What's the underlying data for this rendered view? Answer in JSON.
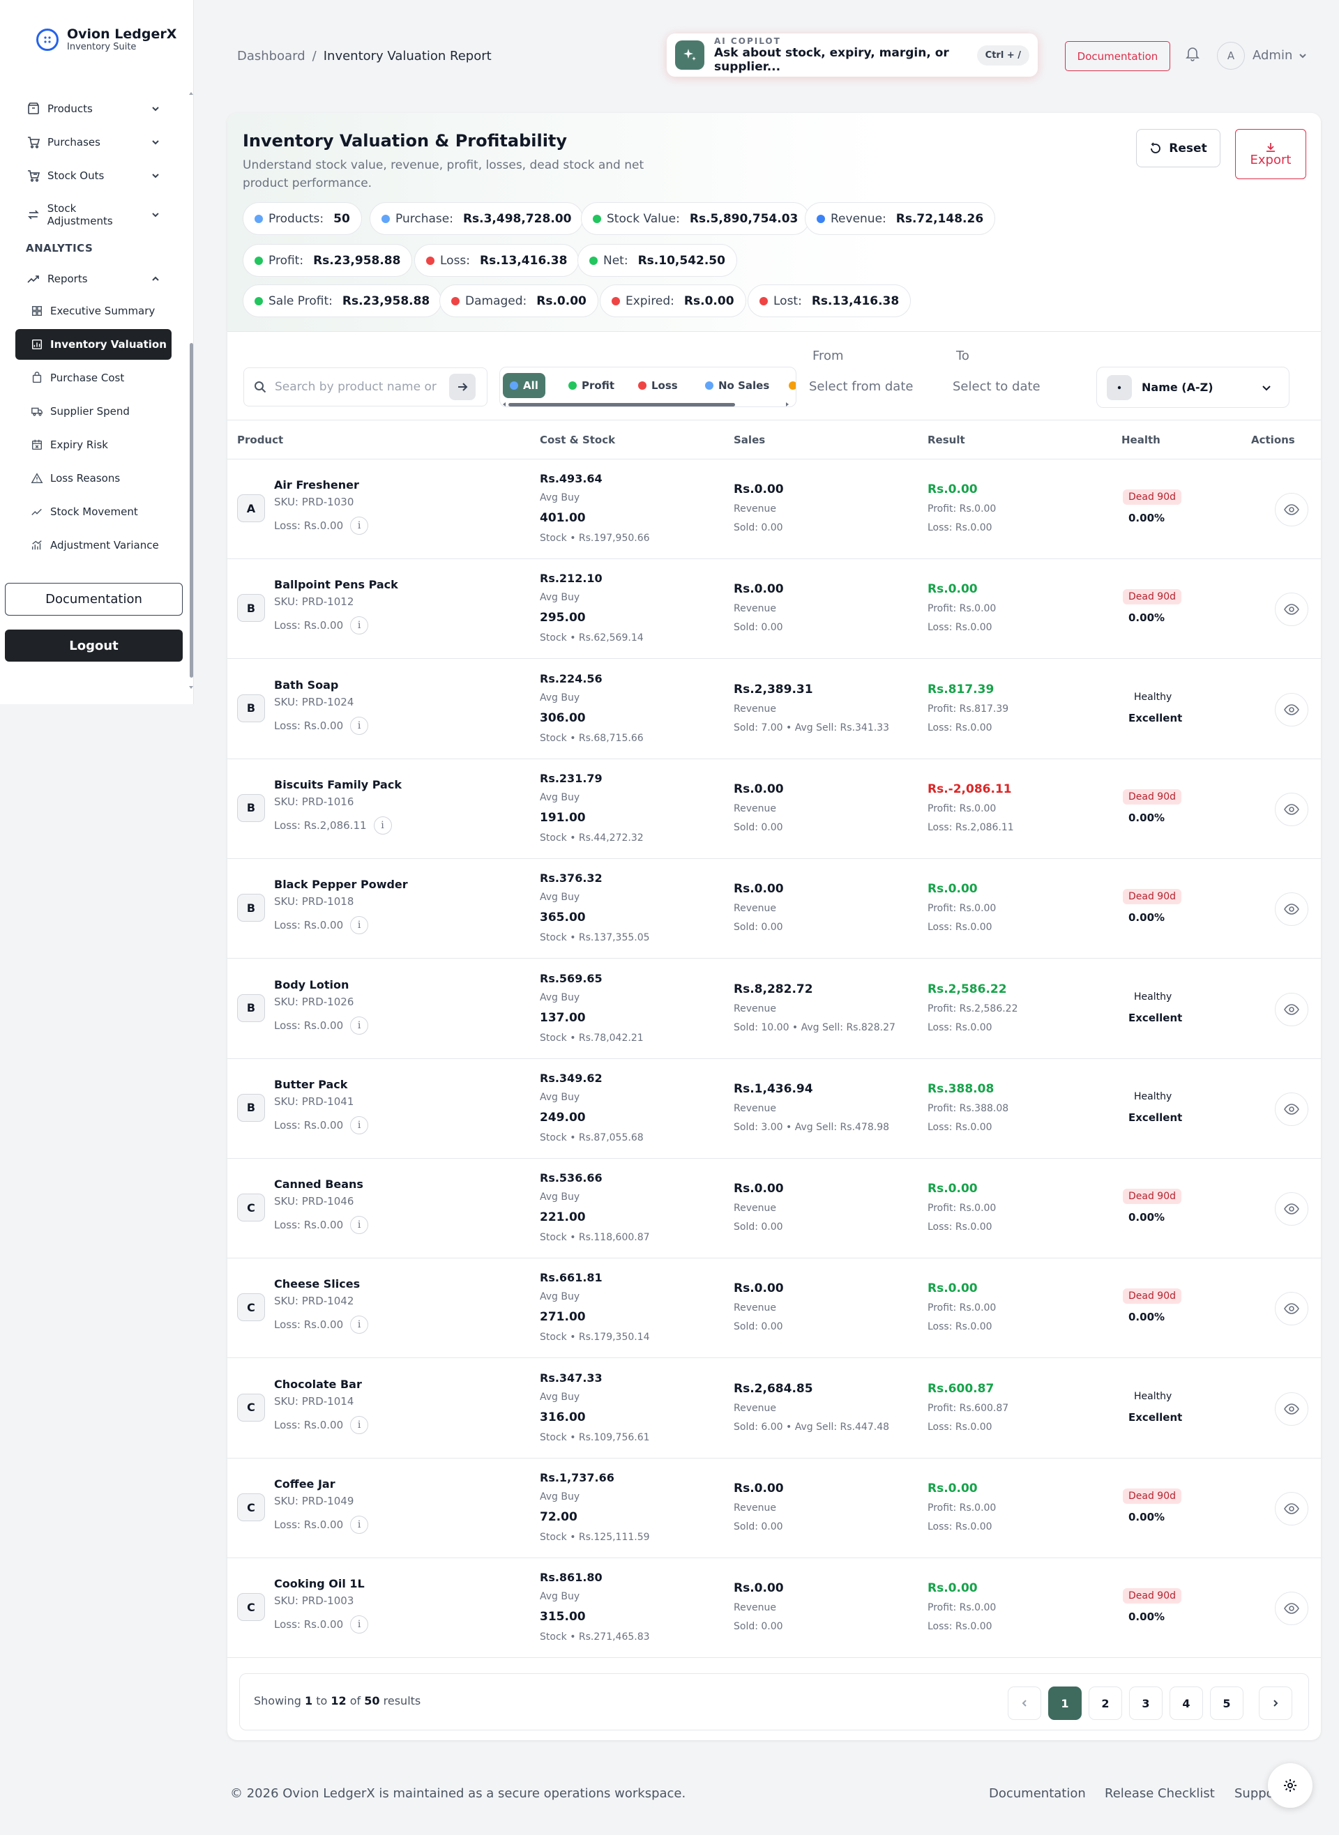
{
  "brand": {
    "name": "Ovion LedgerX",
    "subtitle": "Inventory Suite"
  },
  "nav": {
    "products": "Products",
    "purchases": "Purchases",
    "stock_outs": "Stock Outs",
    "stock_adjustments": "Stock Adjustments",
    "section_analytics": "ANALYTICS",
    "reports": "Reports",
    "sub_items": [
      {
        "label": "Executive Summary",
        "icon": "grid-icon"
      },
      {
        "label": "Inventory Valuation",
        "icon": "chart-box-icon",
        "active": true
      },
      {
        "label": "Purchase Cost",
        "icon": "bag-icon"
      },
      {
        "label": "Supplier Spend",
        "icon": "truck-icon"
      },
      {
        "label": "Expiry Risk",
        "icon": "calendar-x-icon"
      },
      {
        "label": "Loss Reasons",
        "icon": "warning-icon"
      },
      {
        "label": "Stock Movement",
        "icon": "trend-icon"
      },
      {
        "label": "Adjustment Variance",
        "icon": "bar-trend-icon"
      }
    ],
    "documentation": "Documentation",
    "logout": "Logout"
  },
  "breadcrumb": {
    "root": "Dashboard",
    "sep": "/",
    "current": "Inventory Valuation Report"
  },
  "copilot": {
    "title": "AI COPILOT",
    "placeholder": "Ask about stock, expiry, margin, or supplier...",
    "shortcut": "Ctrl + /"
  },
  "header": {
    "documentation": "Documentation",
    "avatar_initial": "A",
    "user": "Admin"
  },
  "report": {
    "title": "Inventory Valuation & Profitability",
    "subtitle": "Understand stock value, revenue, profit, losses, dead stock and net product performance.",
    "reset": "Reset",
    "export": "Export"
  },
  "summary": [
    {
      "label": "Products:",
      "value": "50",
      "color": "#60a5fa"
    },
    {
      "label": "Purchase:",
      "value": "Rs.3,498,728.00",
      "color": "#60a5fa"
    },
    {
      "label": "Stock Value:",
      "value": "Rs.5,890,754.03",
      "color": "#22c55e"
    },
    {
      "label": "Revenue:",
      "value": "Rs.72,148.26",
      "color": "#3b82f6"
    },
    {
      "label": "Profit:",
      "value": "Rs.23,958.88",
      "color": "#22c55e"
    },
    {
      "label": "Loss:",
      "value": "Rs.13,416.38",
      "color": "#ef4444"
    },
    {
      "label": "Net:",
      "value": "Rs.10,542.50",
      "color": "#22c55e"
    },
    {
      "label": "Sale Profit:",
      "value": "Rs.23,958.88",
      "color": "#22c55e"
    },
    {
      "label": "Damaged:",
      "value": "Rs.0.00",
      "color": "#ef4444"
    },
    {
      "label": "Expired:",
      "value": "Rs.0.00",
      "color": "#ef4444"
    },
    {
      "label": "Lost:",
      "value": "Rs.13,416.38",
      "color": "#ef4444"
    }
  ],
  "toolbar": {
    "search_placeholder": "Search by product name or SKU",
    "filters": [
      {
        "label": "All",
        "color": "#60a5fa",
        "active": true
      },
      {
        "label": "Profit",
        "color": "#22c55e"
      },
      {
        "label": "Loss",
        "color": "#ef4444"
      },
      {
        "label": "No Sales",
        "color": "#60a5fa"
      }
    ],
    "from_label": "From",
    "from_placeholder": "Select from date",
    "to_label": "To",
    "to_placeholder": "Select to date",
    "sort": "Name (A-Z)"
  },
  "columns": [
    "Product",
    "Cost & Stock",
    "Sales",
    "Result",
    "Health",
    "Actions"
  ],
  "rows": [
    {
      "initial": "A",
      "name": "Air Freshener",
      "sku": "SKU: PRD-1030",
      "loss": "Loss: Rs.0.00",
      "cost": "Rs.493.64",
      "avg": "Avg Buy",
      "qty": "401.00",
      "stock": "Stock • Rs.197,950.66",
      "sales": "Rs.0.00",
      "rev": "Revenue",
      "sold": "Sold: 0.00",
      "result": "Rs.0.00",
      "result_color": "#16a34a",
      "profit": "Profit: Rs.0.00",
      "rloss": "Loss: Rs.0.00",
      "health": "Dead 90d",
      "health_type": "dead",
      "health_sub": "0.00%"
    },
    {
      "initial": "B",
      "name": "Ballpoint Pens Pack",
      "sku": "SKU: PRD-1012",
      "loss": "Loss: Rs.0.00",
      "cost": "Rs.212.10",
      "avg": "Avg Buy",
      "qty": "295.00",
      "stock": "Stock • Rs.62,569.14",
      "sales": "Rs.0.00",
      "rev": "Revenue",
      "sold": "Sold: 0.00",
      "result": "Rs.0.00",
      "result_color": "#16a34a",
      "profit": "Profit: Rs.0.00",
      "rloss": "Loss: Rs.0.00",
      "health": "Dead 90d",
      "health_type": "dead",
      "health_sub": "0.00%"
    },
    {
      "initial": "B",
      "name": "Bath Soap",
      "sku": "SKU: PRD-1024",
      "loss": "Loss: Rs.0.00",
      "cost": "Rs.224.56",
      "avg": "Avg Buy",
      "qty": "306.00",
      "stock": "Stock • Rs.68,715.66",
      "sales": "Rs.2,389.31",
      "rev": "Revenue",
      "sold": "Sold: 7.00 • Avg Sell: Rs.341.33",
      "result": "Rs.817.39",
      "result_color": "#16a34a",
      "profit": "Profit: Rs.817.39",
      "rloss": "Loss: Rs.0.00",
      "health": "Healthy",
      "health_type": "healthy",
      "health_sub": "Excellent"
    },
    {
      "initial": "B",
      "name": "Biscuits Family Pack",
      "sku": "SKU: PRD-1016",
      "loss": "Loss: Rs.2,086.11",
      "cost": "Rs.231.79",
      "avg": "Avg Buy",
      "qty": "191.00",
      "stock": "Stock • Rs.44,272.32",
      "sales": "Rs.0.00",
      "rev": "Revenue",
      "sold": "Sold: 0.00",
      "result": "Rs.-2,086.11",
      "result_color": "#dc2626",
      "profit": "Profit: Rs.0.00",
      "rloss": "Loss: Rs.2,086.11",
      "health": "Dead 90d",
      "health_type": "dead",
      "health_sub": "0.00%"
    },
    {
      "initial": "B",
      "name": "Black Pepper Powder",
      "sku": "SKU: PRD-1018",
      "loss": "Loss: Rs.0.00",
      "cost": "Rs.376.32",
      "avg": "Avg Buy",
      "qty": "365.00",
      "stock": "Stock • Rs.137,355.05",
      "sales": "Rs.0.00",
      "rev": "Revenue",
      "sold": "Sold: 0.00",
      "result": "Rs.0.00",
      "result_color": "#16a34a",
      "profit": "Profit: Rs.0.00",
      "rloss": "Loss: Rs.0.00",
      "health": "Dead 90d",
      "health_type": "dead",
      "health_sub": "0.00%"
    },
    {
      "initial": "B",
      "name": "Body Lotion",
      "sku": "SKU: PRD-1026",
      "loss": "Loss: Rs.0.00",
      "cost": "Rs.569.65",
      "avg": "Avg Buy",
      "qty": "137.00",
      "stock": "Stock • Rs.78,042.21",
      "sales": "Rs.8,282.72",
      "rev": "Revenue",
      "sold": "Sold: 10.00 • Avg Sell: Rs.828.27",
      "result": "Rs.2,586.22",
      "result_color": "#16a34a",
      "profit": "Profit: Rs.2,586.22",
      "rloss": "Loss: Rs.0.00",
      "health": "Healthy",
      "health_type": "healthy",
      "health_sub": "Excellent"
    },
    {
      "initial": "B",
      "name": "Butter Pack",
      "sku": "SKU: PRD-1041",
      "loss": "Loss: Rs.0.00",
      "cost": "Rs.349.62",
      "avg": "Avg Buy",
      "qty": "249.00",
      "stock": "Stock • Rs.87,055.68",
      "sales": "Rs.1,436.94",
      "rev": "Revenue",
      "sold": "Sold: 3.00 • Avg Sell: Rs.478.98",
      "result": "Rs.388.08",
      "result_color": "#16a34a",
      "profit": "Profit: Rs.388.08",
      "rloss": "Loss: Rs.0.00",
      "health": "Healthy",
      "health_type": "healthy",
      "health_sub": "Excellent"
    },
    {
      "initial": "C",
      "name": "Canned Beans",
      "sku": "SKU: PRD-1046",
      "loss": "Loss: Rs.0.00",
      "cost": "Rs.536.66",
      "avg": "Avg Buy",
      "qty": "221.00",
      "stock": "Stock • Rs.118,600.87",
      "sales": "Rs.0.00",
      "rev": "Revenue",
      "sold": "Sold: 0.00",
      "result": "Rs.0.00",
      "result_color": "#16a34a",
      "profit": "Profit: Rs.0.00",
      "rloss": "Loss: Rs.0.00",
      "health": "Dead 90d",
      "health_type": "dead",
      "health_sub": "0.00%"
    },
    {
      "initial": "C",
      "name": "Cheese Slices",
      "sku": "SKU: PRD-1042",
      "loss": "Loss: Rs.0.00",
      "cost": "Rs.661.81",
      "avg": "Avg Buy",
      "qty": "271.00",
      "stock": "Stock • Rs.179,350.14",
      "sales": "Rs.0.00",
      "rev": "Revenue",
      "sold": "Sold: 0.00",
      "result": "Rs.0.00",
      "result_color": "#16a34a",
      "profit": "Profit: Rs.0.00",
      "rloss": "Loss: Rs.0.00",
      "health": "Dead 90d",
      "health_type": "dead",
      "health_sub": "0.00%"
    },
    {
      "initial": "C",
      "name": "Chocolate Bar",
      "sku": "SKU: PRD-1014",
      "loss": "Loss: Rs.0.00",
      "cost": "Rs.347.33",
      "avg": "Avg Buy",
      "qty": "316.00",
      "stock": "Stock • Rs.109,756.61",
      "sales": "Rs.2,684.85",
      "rev": "Revenue",
      "sold": "Sold: 6.00 • Avg Sell: Rs.447.48",
      "result": "Rs.600.87",
      "result_color": "#16a34a",
      "profit": "Profit: Rs.600.87",
      "rloss": "Loss: Rs.0.00",
      "health": "Healthy",
      "health_type": "healthy",
      "health_sub": "Excellent"
    },
    {
      "initial": "C",
      "name": "Coffee Jar",
      "sku": "SKU: PRD-1049",
      "loss": "Loss: Rs.0.00",
      "cost": "Rs.1,737.66",
      "avg": "Avg Buy",
      "qty": "72.00",
      "stock": "Stock • Rs.125,111.59",
      "sales": "Rs.0.00",
      "rev": "Revenue",
      "sold": "Sold: 0.00",
      "result": "Rs.0.00",
      "result_color": "#16a34a",
      "profit": "Profit: Rs.0.00",
      "rloss": "Loss: Rs.0.00",
      "health": "Dead 90d",
      "health_type": "dead",
      "health_sub": "0.00%"
    },
    {
      "initial": "C",
      "name": "Cooking Oil 1L",
      "sku": "SKU: PRD-1003",
      "loss": "Loss: Rs.0.00",
      "cost": "Rs.861.80",
      "avg": "Avg Buy",
      "qty": "315.00",
      "stock": "Stock • Rs.271,465.83",
      "sales": "Rs.0.00",
      "rev": "Revenue",
      "sold": "Sold: 0.00",
      "result": "Rs.0.00",
      "result_color": "#16a34a",
      "profit": "Profit: Rs.0.00",
      "rloss": "Loss: Rs.0.00",
      "health": "Dead 90d",
      "health_type": "dead",
      "health_sub": "0.00%"
    }
  ],
  "pagination": {
    "showing": "Showing",
    "from": "1",
    "to_word": "to",
    "to": "12",
    "of_word": "of",
    "total": "50",
    "results": "results",
    "pages": [
      "1",
      "2",
      "3",
      "4",
      "5"
    ],
    "current": "1"
  },
  "footer": {
    "copyright": "© 2026 Ovion LedgerX is maintained as a secure operations workspace.",
    "links": [
      "Documentation",
      "Release Checklist",
      "Support"
    ]
  }
}
